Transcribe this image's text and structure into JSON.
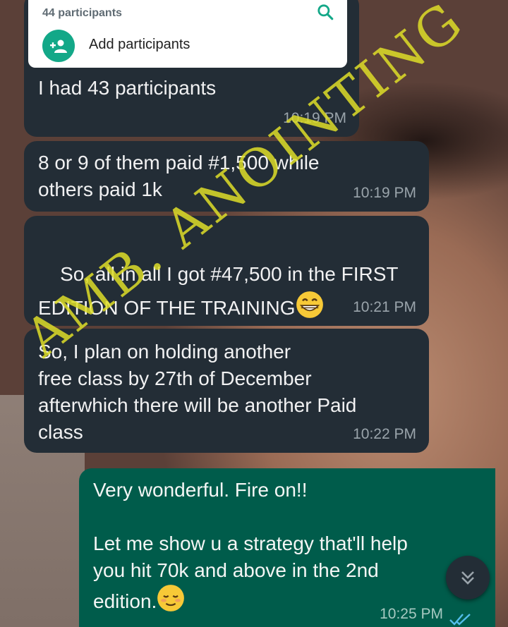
{
  "group_card": {
    "participants_count": "44 participants",
    "add_label": "Add participants"
  },
  "messages": [
    {
      "text": "I had 43 participants",
      "time": "10:19 PM"
    },
    {
      "text": "8 or 9 of them paid #1,500 while\nothers paid 1k",
      "time": "10:19 PM"
    },
    {
      "text": "So, all in all I got #47,500 in the FIRST\nEDITION OF THE TRAINING",
      "time": "10:21 PM"
    },
    {
      "text": "So, I plan on holding another\nfree class by 27th of December\nafterwhich there will be another Paid\nclass",
      "time": "10:22 PM"
    }
  ],
  "outgoing": {
    "line1": "Very wonderful. Fire on!!",
    "line2": "Let me show u a strategy that'll help\nyou hit 70k and above in the 2nd\nedition.",
    "time": "10:25 PM"
  },
  "watermark": "AMB. ANOINTING",
  "colors": {
    "incoming_bubble": "#232d36",
    "outgoing_bubble": "#005c4b",
    "accent": "#13a888",
    "watermark": "#dede28"
  },
  "icons": [
    "search-icon",
    "add-person-icon",
    "grinning-emoji",
    "relieved-emoji",
    "double-check-icon",
    "chevron-double-down-icon"
  ]
}
